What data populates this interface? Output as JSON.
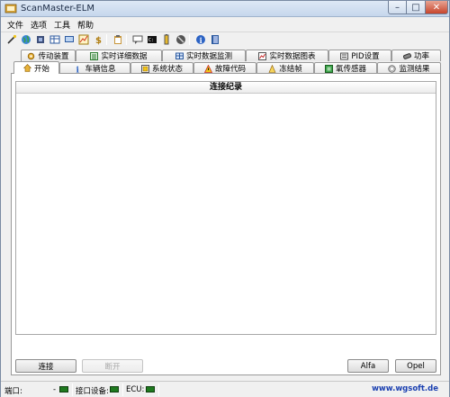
{
  "window": {
    "title": "ScanMaster-ELM",
    "minimize": "–",
    "maximize": "□",
    "close": "✕"
  },
  "menu": [
    "文件",
    "选项",
    "工具",
    "帮助"
  ],
  "toolbar_icons": [
    "wand-icon",
    "globe-icon",
    "chip-icon",
    "grid-icon",
    "display-icon",
    "chart-icon",
    "money-icon",
    "clipboard-icon",
    "comment-icon",
    "terminal-icon",
    "battery-icon",
    "disc-icon",
    "info-icon",
    "book-icon"
  ],
  "tabs": {
    "row1": [
      {
        "label": "传动装置",
        "icon": "gear-icon"
      },
      {
        "label": "实时详细数据",
        "icon": "list-icon"
      },
      {
        "label": "实时数据监测",
        "icon": "monitor-icon"
      },
      {
        "label": "实时数据图表",
        "icon": "graph-icon"
      },
      {
        "label": "PID设置",
        "icon": "settings-icon"
      },
      {
        "label": "功率",
        "icon": "power-icon"
      }
    ],
    "row2": [
      {
        "label": "开始",
        "icon": "home-icon",
        "active": true
      },
      {
        "label": "车辆信息",
        "icon": "info-icon"
      },
      {
        "label": "系统状态",
        "icon": "status-icon"
      },
      {
        "label": "故障代码",
        "icon": "warning-icon"
      },
      {
        "label": "冻结帧",
        "icon": "freeze-icon"
      },
      {
        "label": "氧传感器",
        "icon": "sensor-icon"
      },
      {
        "label": "监测结果",
        "icon": "result-icon"
      }
    ]
  },
  "main": {
    "column_header": "连接纪录"
  },
  "buttons": {
    "connect": "连接",
    "disconnect": "断开",
    "alfa": "Alfa",
    "opel": "Opel"
  },
  "status": {
    "port_label": "端口:",
    "port_value": "-",
    "interface_label": "接口设备:",
    "ecu_label": "ECU:",
    "url": "www.wgsoft.de"
  },
  "colors": {
    "led": "#1f7a1f",
    "url": "#1a3fb0"
  }
}
